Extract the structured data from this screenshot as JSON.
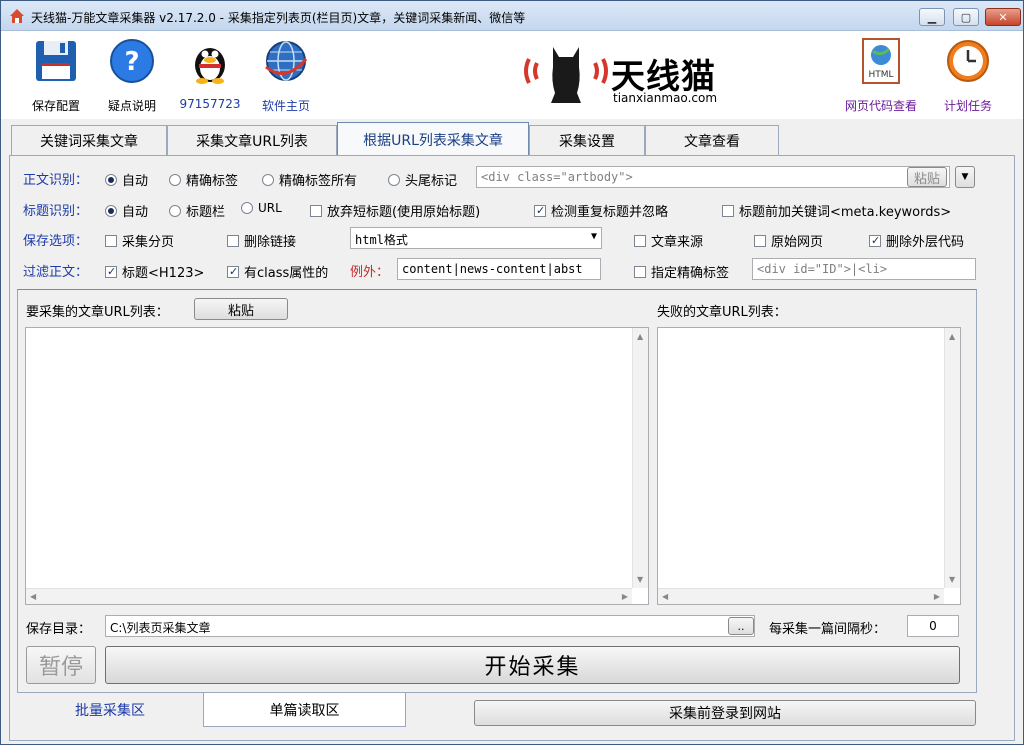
{
  "window": {
    "title": "天线猫-万能文章采集器 v2.17.2.0 - 采集指定列表页(栏目页)文章，关键词采集新闻、微信等",
    "minimize_glyph": "▁",
    "maximize_glyph": "▢",
    "close_glyph": "✕"
  },
  "toolbar": {
    "save_config": "保存配置",
    "help": "疑点说明",
    "qq": "97157723",
    "homepage": "软件主页",
    "view_html": "网页代码查看",
    "schedule": "计划任务"
  },
  "logo": {
    "brand": "天线猫",
    "domain": "tianxianmao.com"
  },
  "tabs": [
    {
      "label": "关键词采集文章"
    },
    {
      "label": "采集文章URL列表"
    },
    {
      "label": "根据URL列表采集文章"
    },
    {
      "label": "采集设置"
    },
    {
      "label": "文章查看"
    }
  ],
  "body_detect": {
    "label": "正文识别：",
    "opt_auto": "自动",
    "opt_exact_tag": "精确标签",
    "opt_exact_all": "精确标签所有",
    "opt_head_tail": "头尾标记",
    "input_value": "<div class=\"artbody\">",
    "paste_label": "粘贴",
    "dropdown_glyph": "▼"
  },
  "title_detect": {
    "label": "标题识别：",
    "opt_auto": "自动",
    "opt_title_bar": "标题栏",
    "opt_url": "URL",
    "discard_short": "放弃短标题(使用原始标题)",
    "dedupe": "检测重复标题并忽略",
    "prefix_keywords": "标题前加关键词<meta.keywords>"
  },
  "save_options": {
    "label": "保存选项：",
    "paging": "采集分页",
    "remove_links": "删除链接",
    "format_value": "html格式",
    "article_source": "文章来源",
    "original_page": "原始网页",
    "remove_outer": "删除外层代码"
  },
  "filter": {
    "label": "过滤正文：",
    "title_h123": "标题<H123>",
    "has_class": "有class属性的",
    "exception_label": "例外：",
    "exception_value": "content|news-content|abst",
    "exact_tag": "指定精确标签",
    "exact_tag_value": "<div id=\"ID\">|<li>"
  },
  "url_panel": {
    "list_label": "要采集的文章URL列表：",
    "paste_label": "粘贴",
    "failed_label": "失败的文章URL列表："
  },
  "save_dir": {
    "label": "保存目录：",
    "value": "C:\\列表页采集文章",
    "browse": "..",
    "interval_label": "每采集一篇间隔秒：",
    "interval_value": "0"
  },
  "actions": {
    "pause": "暂停",
    "start": "开始采集"
  },
  "bottom_tabs": {
    "batch": "批量采集区",
    "single": "单篇读取区",
    "login": "采集前登录到网站"
  },
  "colors": {
    "accent": "#1c3aa8",
    "exception": "#c62828",
    "active_tab": "#1a3f84"
  }
}
